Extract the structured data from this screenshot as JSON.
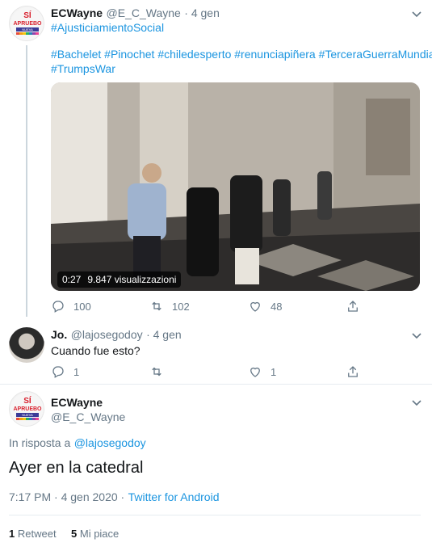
{
  "tweet1": {
    "display_name": "ECWayne",
    "handle": "@E_C_Wayne",
    "time": "· 4 gen",
    "line1": "#AjusticiamientoSocial",
    "line2": "#Bachelet #Pinochet #chiledesperto #renunciapiñera #TerceraGuerraMundial",
    "line3": "#TrumpsWar",
    "video_duration": "0:27",
    "video_views": "9.847 visualizzazioni",
    "replies": "100",
    "retweets": "102",
    "likes": "48"
  },
  "tweet2": {
    "display_name": "Jo.",
    "handle": "@lajosegodoy",
    "time": "· 4 gen",
    "text": "Cuando fue esto?",
    "replies": "1",
    "likes": "1"
  },
  "main": {
    "display_name": "ECWayne",
    "handle": "@E_C_Wayne",
    "reply_prefix": "In risposta a",
    "reply_to": "@lajosegodoy",
    "text": "Ayer en la catedral",
    "timestamp": "7:17 PM · 4 gen 2020 ·",
    "source": "Twitter for Android",
    "retweets_count": "1",
    "retweets_label": "Retweet",
    "likes_count": "5",
    "likes_label": "Mi piace"
  },
  "avatar_logo": {
    "top": "SÍ",
    "mid": "APRUEBO",
    "bottom": "NUEVA"
  },
  "colors": {
    "link": "#1b95e0",
    "muted": "#657786",
    "text": "#14171a",
    "divider": "#e6ecf0"
  }
}
